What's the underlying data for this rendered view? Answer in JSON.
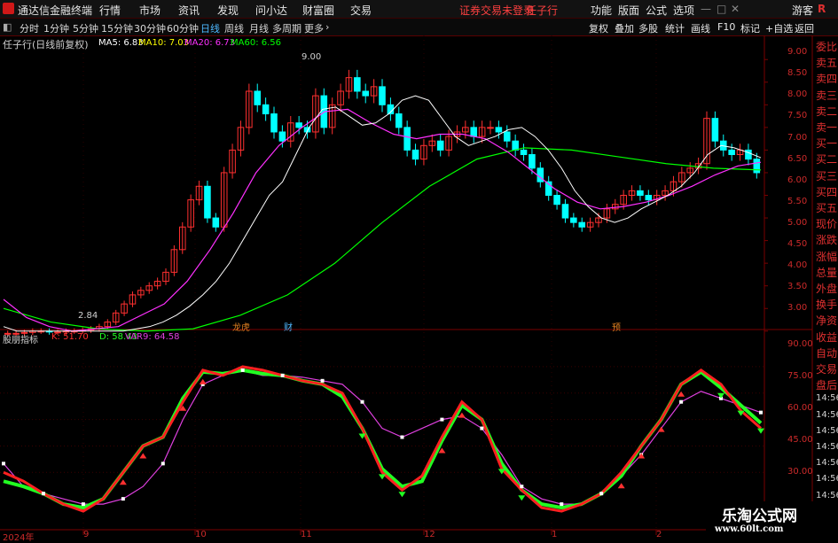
{
  "menubar": {
    "app_title": "通达信金融终端",
    "items": [
      "行情",
      "市场",
      "资讯",
      "发现",
      "问小达",
      "财富圈",
      "交易"
    ],
    "login_status": "证券交易未登录",
    "stock_name": "任子行",
    "right_items": [
      "功能",
      "版面",
      "公式",
      "选项"
    ],
    "guest": "游客",
    "r_label": "R"
  },
  "toolbar": {
    "periods": [
      "分时",
      "1分钟",
      "5分钟",
      "15分钟",
      "30分钟",
      "60分钟",
      "日线",
      "周线",
      "月线",
      "多周期",
      "更多"
    ],
    "active_period": "日线",
    "right_buttons": [
      "复权",
      "叠加",
      "多股",
      "统计",
      "画线",
      "F10",
      "标记",
      "+自选",
      "返回"
    ]
  },
  "main_chart": {
    "title": "任子行(日线前复权)",
    "ma_labels": [
      {
        "text": "MA5: 6.83",
        "color": "#ffffff"
      },
      {
        "text": "MA10: 7.03",
        "color": "#ffff00"
      },
      {
        "text": "MA20: 6.73",
        "color": "#ff30ff"
      },
      {
        "text": "MA60: 6.56",
        "color": "#00ff00"
      }
    ],
    "high_label": "9.00",
    "low_label": "2.84",
    "y_ticks": [
      "9.00",
      "8.50",
      "8.00",
      "7.50",
      "7.00",
      "6.50",
      "6.00",
      "5.50",
      "5.00",
      "4.50",
      "4.00",
      "3.50",
      "3.00"
    ],
    "event_tags": [
      "龙虎",
      "财",
      "预"
    ]
  },
  "indicator": {
    "name": "股朋指标",
    "k": "K: 51.70",
    "d": "D: 58.43",
    "var9": "VAR9: 64.58",
    "y_ticks": [
      "90.00",
      "75.00",
      "60.00",
      "45.00",
      "30.00"
    ]
  },
  "x_axis": [
    "2024年",
    "9",
    "10",
    "11",
    "12",
    "1",
    "2"
  ],
  "right_panel": {
    "items": [
      "委比",
      "卖五",
      "卖四",
      "卖三",
      "卖二",
      "卖一",
      "买一",
      "买二",
      "买三",
      "买四",
      "买五",
      "现价",
      "涨跌",
      "涨幅",
      "总量",
      "外盘",
      "换手",
      "净资",
      "收益",
      "自动",
      "交易",
      "盘后",
      "14:56",
      "14:56",
      "14:56",
      "14:56",
      "14:56",
      "14:56",
      "14:56",
      "14:56"
    ]
  },
  "watermark": {
    "line1": "乐淘公式网",
    "line2": "www.60lt.com"
  },
  "colors": {
    "up": "#ff3030",
    "down": "#00ffff",
    "ma5": "#ffffff",
    "ma10": "#ffff00",
    "ma20": "#ff30ff",
    "ma60": "#00ff00",
    "k": "#ff2020",
    "d": "#22ff22",
    "var9": "#e040e0",
    "grid": "#7a0000"
  },
  "chart_data": {
    "type": "candlestick",
    "price_axis": {
      "min": 2.8,
      "max": 9.2
    },
    "closes": [
      2.95,
      2.95,
      2.97,
      3.0,
      3.0,
      2.98,
      2.98,
      3.0,
      3.0,
      3.02,
      3.05,
      3.1,
      3.2,
      3.4,
      3.6,
      3.8,
      3.9,
      4.0,
      4.1,
      4.3,
      4.8,
      5.3,
      5.9,
      6.2,
      5.5,
      5.3,
      6.5,
      7.0,
      7.5,
      8.3,
      8.0,
      7.8,
      7.4,
      7.2,
      7.6,
      7.5,
      7.4,
      8.2,
      7.5,
      8.0,
      8.3,
      8.6,
      8.3,
      8.2,
      8.4,
      8.0,
      7.8,
      7.5,
      7.0,
      6.8,
      7.1,
      7.2,
      7.0,
      7.3,
      7.4,
      7.5,
      7.3,
      7.5,
      7.5,
      7.4,
      7.2,
      7.0,
      6.9,
      6.6,
      6.3,
      6.0,
      5.8,
      5.5,
      5.4,
      5.3,
      5.4,
      5.5,
      5.7,
      5.8,
      6.0,
      6.1,
      6.0,
      5.9,
      6.0,
      6.1,
      6.3,
      6.5,
      6.6,
      6.7,
      7.7,
      7.2,
      7.0,
      6.9,
      7.0,
      6.8,
      6.5
    ],
    "ma5": [
      3.1,
      3.0,
      3.0,
      3.0,
      3.0,
      3.0,
      3.0,
      3.0,
      3.0,
      3.0,
      3.05,
      3.1,
      3.2,
      3.35,
      3.55,
      3.8,
      4.1,
      4.5,
      5.0,
      5.5,
      6.0,
      6.3,
      6.9,
      7.5,
      7.9,
      7.95,
      7.75,
      7.55,
      7.6,
      7.8,
      8.1,
      8.2,
      8.1,
      7.7,
      7.3,
      7.1,
      7.2,
      7.3,
      7.45,
      7.5,
      7.3,
      7.0,
      6.6,
      6.1,
      5.75,
      5.5,
      5.4,
      5.5,
      5.7,
      5.85,
      6.0,
      6.2,
      6.5,
      6.9,
      7.1,
      7.05,
      6.95,
      6.83
    ],
    "ma20": [
      3.7,
      3.3,
      3.1,
      3.0,
      3.05,
      3.1,
      3.35,
      3.6,
      4.1,
      4.8,
      5.6,
      6.5,
      7.1,
      7.5,
      7.85,
      7.9,
      7.6,
      7.35,
      7.25,
      7.35,
      7.35,
      7.25,
      6.95,
      6.55,
      6.15,
      5.85,
      5.7,
      5.75,
      5.85,
      6.0,
      6.2,
      6.45,
      6.65,
      6.73
    ],
    "ma60": [
      3.5,
      3.2,
      3.05,
      3.0,
      3.05,
      3.35,
      3.8,
      4.5,
      5.4,
      6.2,
      6.8,
      7.05,
      7.0,
      6.85,
      6.7,
      6.6,
      6.56
    ],
    "k_line": [
      30,
      25,
      18,
      12,
      8,
      15,
      30,
      45,
      50,
      70,
      88,
      85,
      90,
      88,
      85,
      82,
      80,
      75,
      55,
      30,
      20,
      28,
      50,
      70,
      60,
      32,
      20,
      10,
      8,
      12,
      18,
      30,
      45,
      60,
      80,
      88,
      80,
      65,
      55
    ],
    "d_line": [
      25,
      22,
      18,
      12,
      10,
      15,
      30,
      45,
      50,
      72,
      87,
      86,
      88,
      86,
      85,
      82,
      80,
      73,
      55,
      32,
      22,
      25,
      48,
      68,
      60,
      35,
      20,
      12,
      10,
      12,
      18,
      28,
      45,
      60,
      80,
      87,
      78,
      68,
      58
    ],
    "var9_line": [
      35,
      22,
      18,
      15,
      12,
      12,
      15,
      22,
      35,
      60,
      80,
      85,
      88,
      85,
      85,
      84,
      82,
      80,
      70,
      55,
      50,
      55,
      60,
      62,
      55,
      40,
      22,
      15,
      12,
      12,
      18,
      28,
      40,
      55,
      70,
      76,
      72,
      68,
      64
    ]
  }
}
